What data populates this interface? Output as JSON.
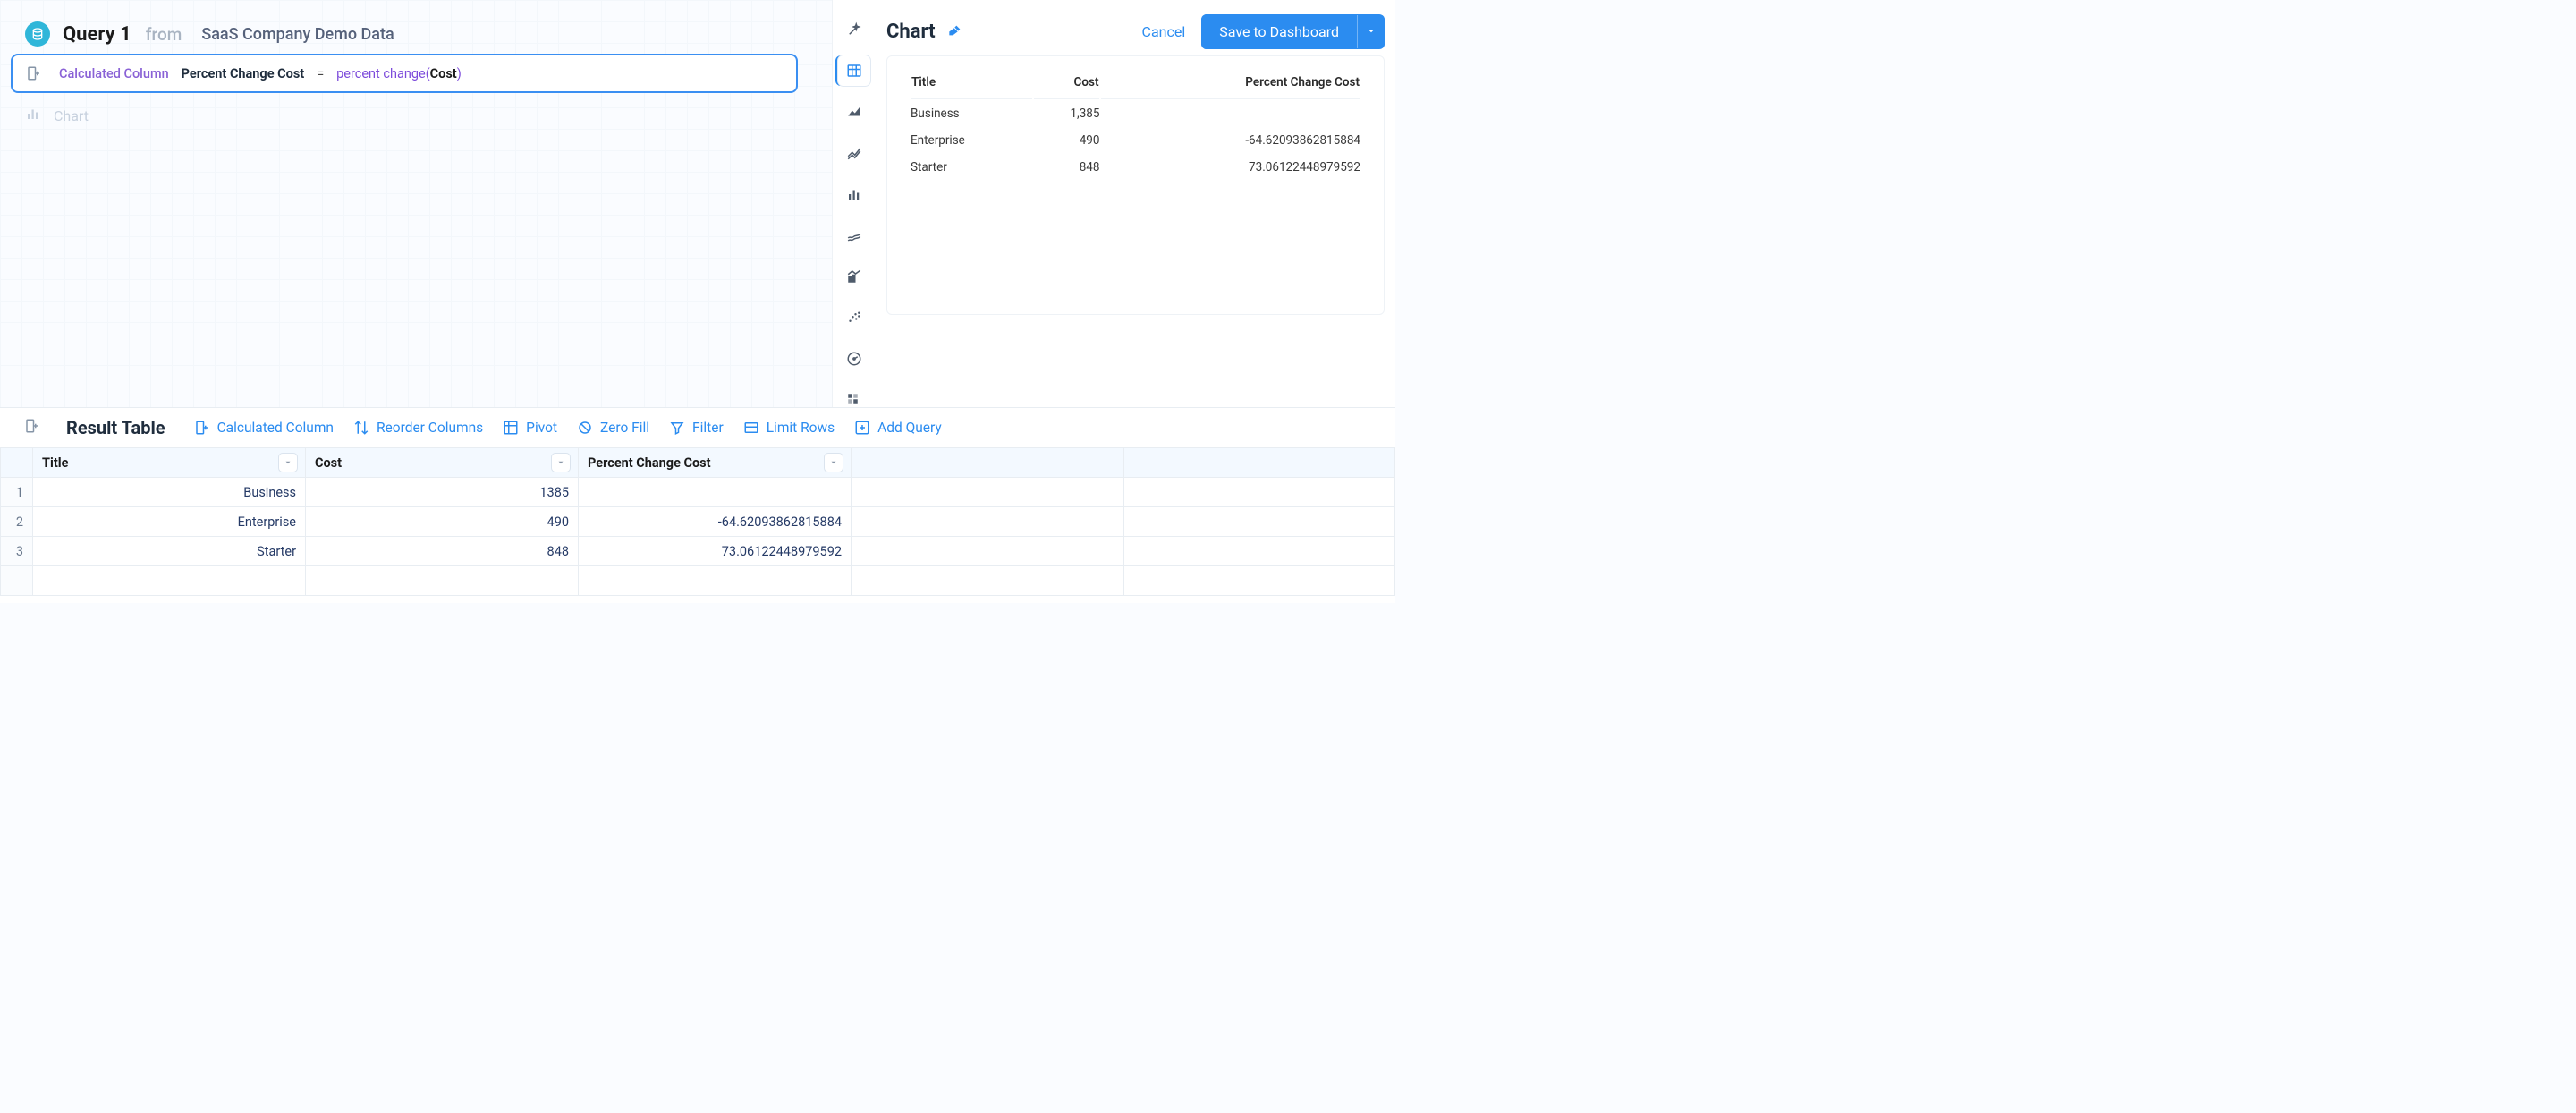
{
  "query": {
    "name": "Query 1",
    "from_label": "from",
    "source": "SaaS Company Demo Data"
  },
  "formula": {
    "prefix_label": "Calculated Column",
    "column_name": "Percent Change Cost",
    "equals": "=",
    "fn_open": "percent change(",
    "fn_arg": "Cost",
    "fn_close": ")"
  },
  "chart_placeholder_label": "Chart",
  "chart_panel": {
    "title": "Chart",
    "cancel": "Cancel",
    "save": "Save to Dashboard"
  },
  "chart_data": {
    "type": "table",
    "columns": [
      "Title",
      "Cost",
      "Percent Change Cost"
    ],
    "rows": [
      {
        "title": "Business",
        "cost": "1,385",
        "pcc": ""
      },
      {
        "title": "Enterprise",
        "cost": "490",
        "pcc": "-64.62093862815884"
      },
      {
        "title": "Starter",
        "cost": "848",
        "pcc": "73.06122448979592"
      }
    ]
  },
  "result": {
    "title": "Result Table",
    "tools": {
      "calc": "Calculated Column",
      "reorder": "Reorder Columns",
      "pivot": "Pivot",
      "zero": "Zero Fill",
      "filter": "Filter",
      "limit": "Limit Rows",
      "add": "Add Query"
    },
    "headers": [
      "Title",
      "Cost",
      "Percent Change Cost"
    ],
    "rows": [
      {
        "n": "1",
        "title": "Business",
        "cost": "1385",
        "pcc": ""
      },
      {
        "n": "2",
        "title": "Enterprise",
        "cost": "490",
        "pcc": "-64.62093862815884"
      },
      {
        "n": "3",
        "title": "Starter",
        "cost": "848",
        "pcc": "73.06122448979592"
      }
    ]
  }
}
